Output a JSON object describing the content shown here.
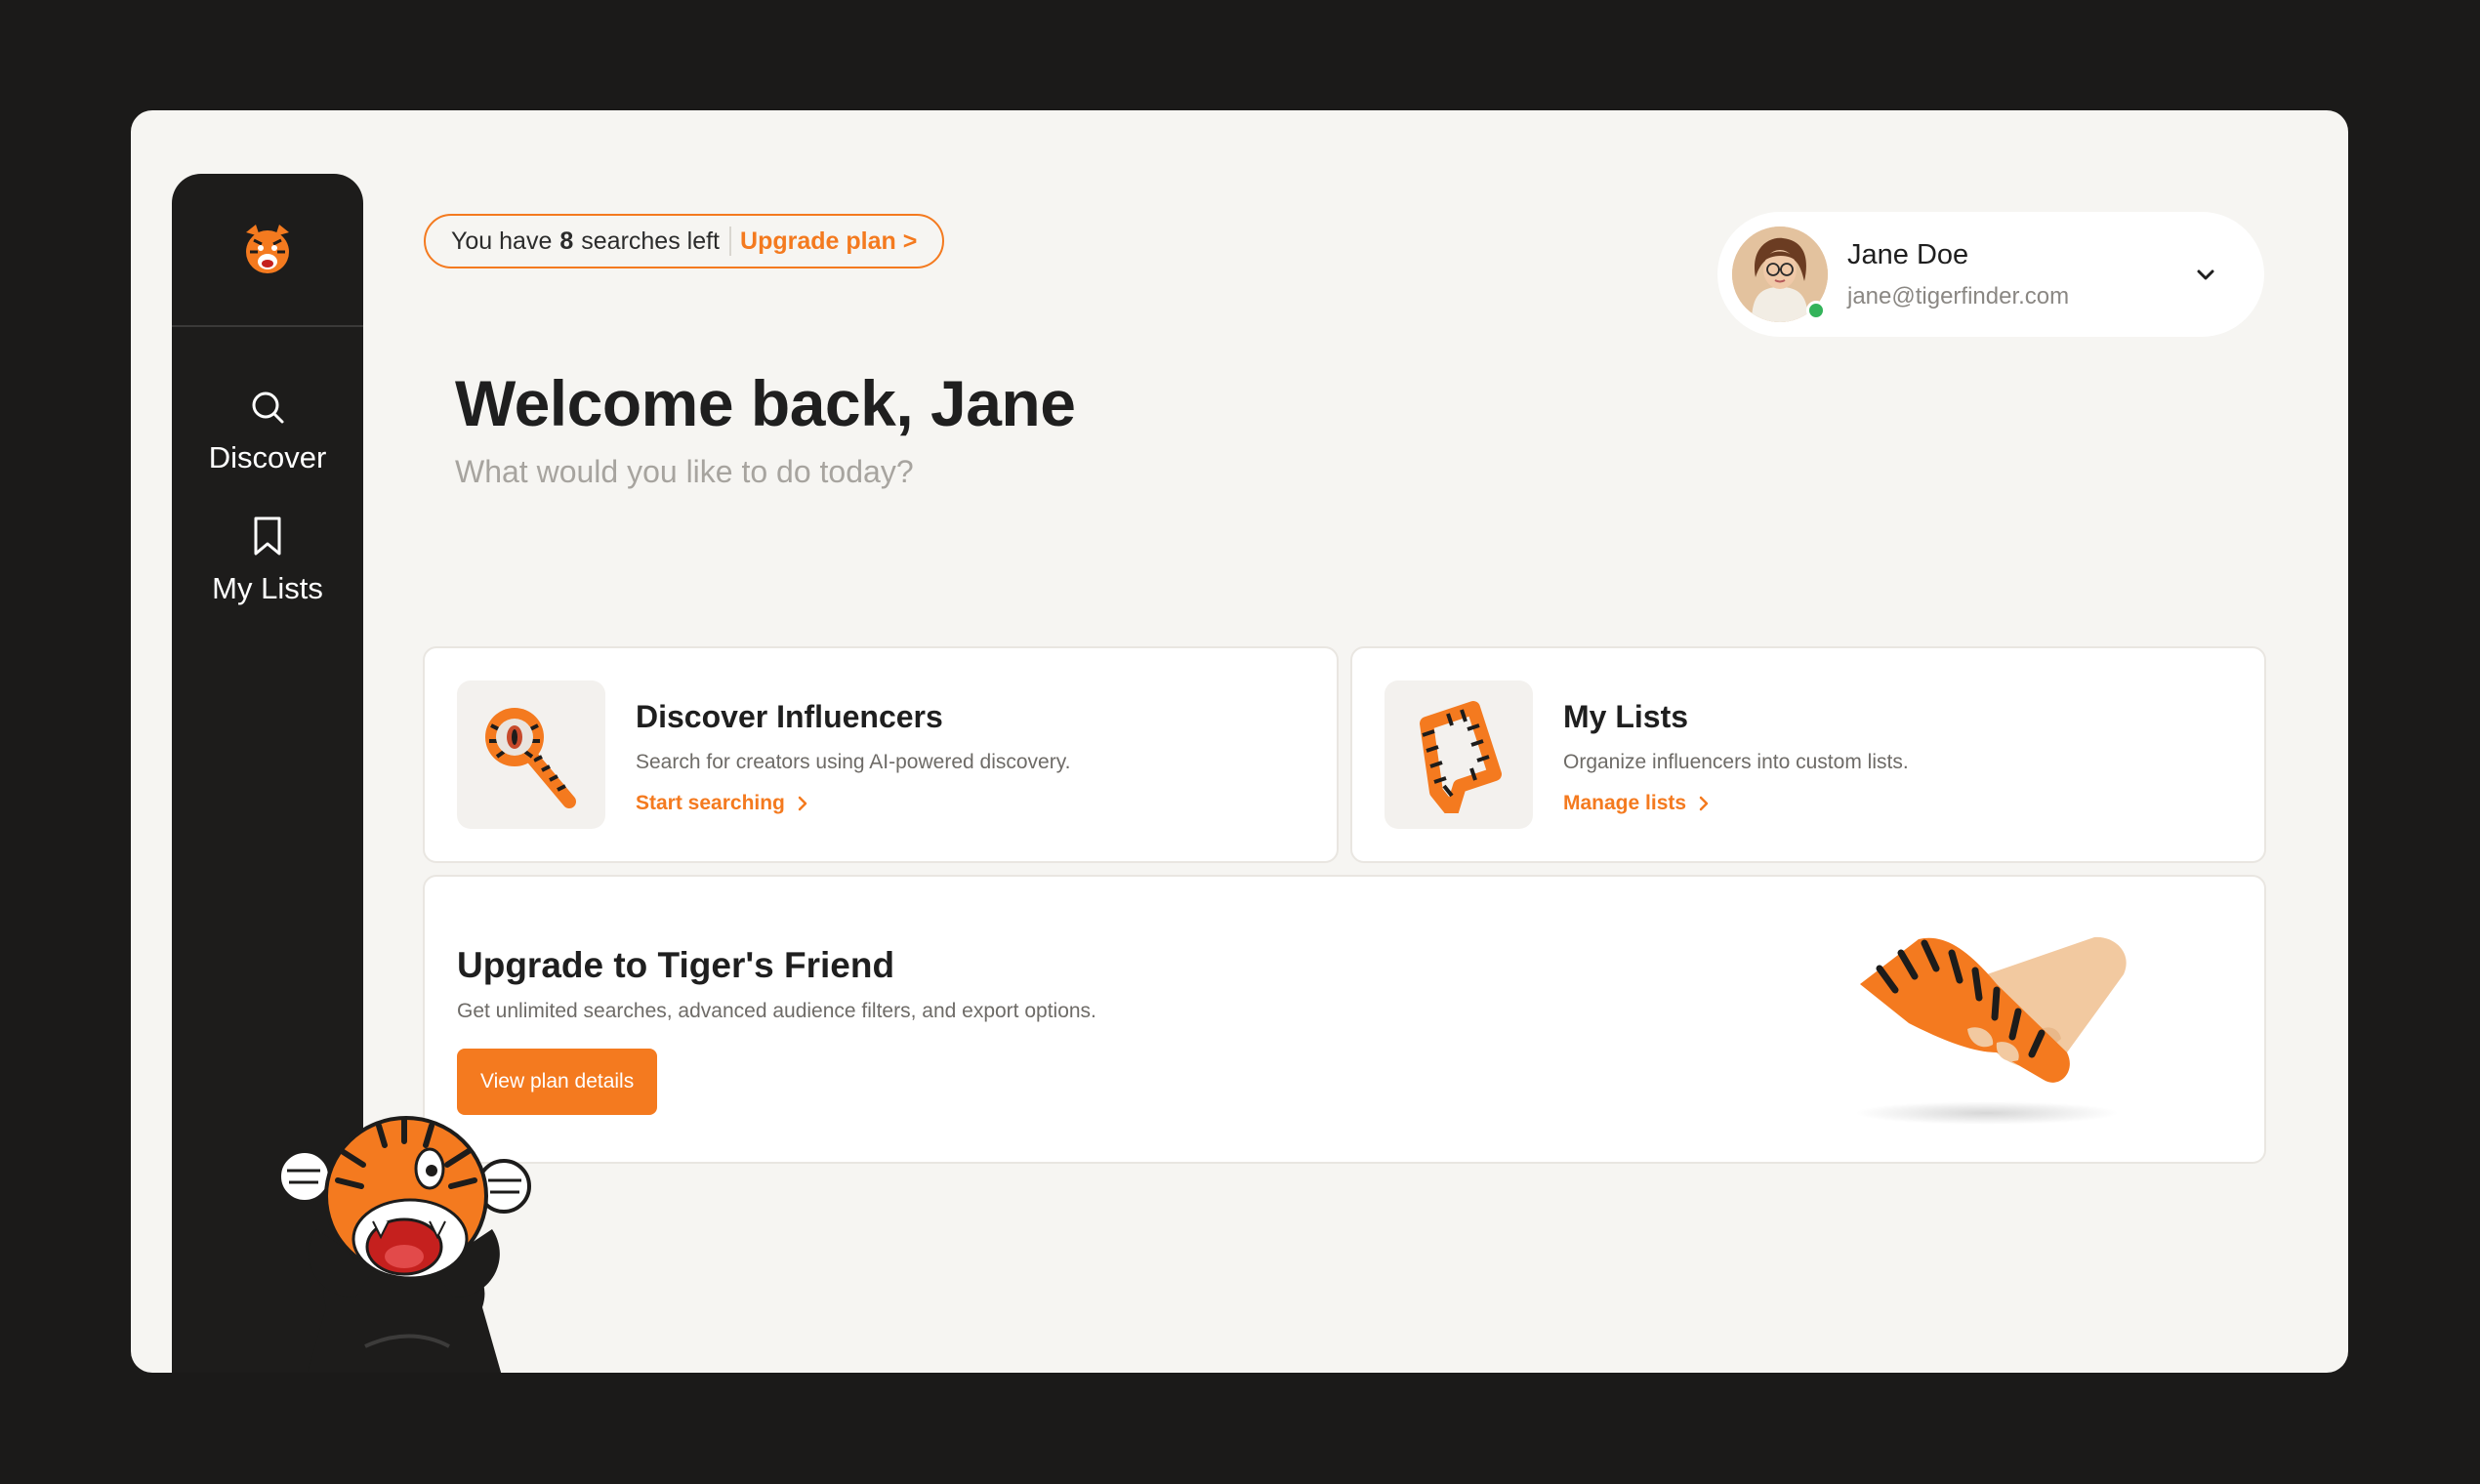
{
  "sidebar": {
    "logo": "tiger-head-logo",
    "items": [
      {
        "label": "Discover",
        "icon": "search-icon"
      },
      {
        "label": "My Lists",
        "icon": "bookmark-icon"
      }
    ]
  },
  "usage": {
    "prefix": "You have",
    "count": "8",
    "suffix": "searches left",
    "upgrade_link": "Upgrade plan >"
  },
  "user": {
    "name": "Jane Doe",
    "email": "jane@tigerfinder.com",
    "status": "online"
  },
  "welcome": {
    "title": "Welcome back, Jane",
    "subtitle": "What would you like to do today?"
  },
  "cards": {
    "discover": {
      "title": "Discover Influencers",
      "description": "Search for creators using AI-powered discovery.",
      "link": "Start searching",
      "icon": "tiger-magnifier-icon"
    },
    "lists": {
      "title": "My Lists",
      "description": "Organize influencers into custom lists.",
      "link": "Manage lists",
      "icon": "tiger-bookmark-icon"
    },
    "upgrade": {
      "title": "Upgrade to Tiger's Friend",
      "description": "Get unlimited searches, advanced audience filters, and export options.",
      "button": "View plan details",
      "illustration": "tiger-handshake"
    }
  },
  "colors": {
    "accent": "#f47a1f",
    "sidebar": "#1d1c1b",
    "background": "#f6f5f2",
    "online": "#33b35a"
  }
}
